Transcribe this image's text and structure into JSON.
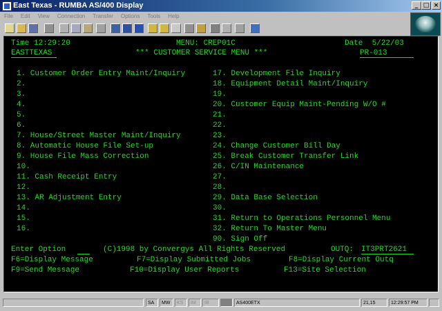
{
  "window": {
    "title": "East Texas - RUMBA AS/400 Display"
  },
  "menubar": [
    "File",
    "Edit",
    "View",
    "Connection",
    "Transfer",
    "Options",
    "Tools",
    "Help"
  ],
  "toolbar_icons": [
    "new-session-icon",
    "open-icon",
    "save-icon",
    "print-icon",
    "cut-icon",
    "copy-icon",
    "paste-icon",
    "clear-icon",
    "connect-icon",
    "disconnect-icon",
    "transfer-icon",
    "send-file-icon",
    "receive-file-icon",
    "macro-icon",
    "record-macro-icon",
    "keyboard-map-icon",
    "hotspot-icon",
    "options-icon",
    "about-icon"
  ],
  "screen": {
    "time_line": "Time 12:29:20",
    "menu_line": "MENU: CREP01C",
    "date_line": "Date  5/22/03",
    "company": "EASTTEXAS",
    "heading": "*** CUSTOMER SERVICE MENU ***",
    "screen_id": "PR-013",
    "left_items": [
      "1. Customer Order Entry Maint/Inquiry",
      "2.",
      "3.",
      "4.",
      "5.",
      "6.",
      "7. House/Street Master Maint/Inquiry",
      "8. Automatic House File Set-up",
      "9. House File Mass Correction",
      "10.",
      "11. Cash Receipt Entry",
      "12.",
      "13. AR Adjustment Entry",
      "14.",
      "15.",
      "16."
    ],
    "right_items": [
      "17. Development File Inquiry",
      "18. Equipment Detail Maint/Inquiry",
      "19.",
      "20. Customer Equip Maint-Pending W/O #",
      "21.",
      "22.",
      "23.",
      "24. Change Customer Bill Day",
      "25. Break Customer Transfer Link",
      "26. C/IN Maintenance",
      "27.",
      "28.",
      "29. Data Base Selection",
      "30.",
      "31. Return to Operations Personnel Menu",
      "32. Return To Master Menu",
      "90. Sign Off"
    ],
    "enter_option_label": "Enter Option",
    "copyright": "(C)1998 by Convergys All Rights Reserved",
    "outq_label": "OUTQ:",
    "outq_value": "IT3PRT2621",
    "fkeys_row1": [
      "F6=Display Message",
      "F7=Display Submitted Jobs",
      "F8=Display Current Outq"
    ],
    "fkeys_row2": [
      "F9=Send Message",
      "F10=Display User Reports",
      "F13=Site Selection"
    ]
  },
  "statusbar": {
    "sa": "SA",
    "mw": "MW",
    "ks": "KS",
    "im": "IM",
    "ib": "IB",
    "session": "AS400ETX",
    "cursor": "21,15",
    "clock": "12:29:57 PM"
  },
  "colors": {
    "screen_bg": "#000000",
    "screen_text": "#1edd1e",
    "titlebar": "#0a246a"
  }
}
